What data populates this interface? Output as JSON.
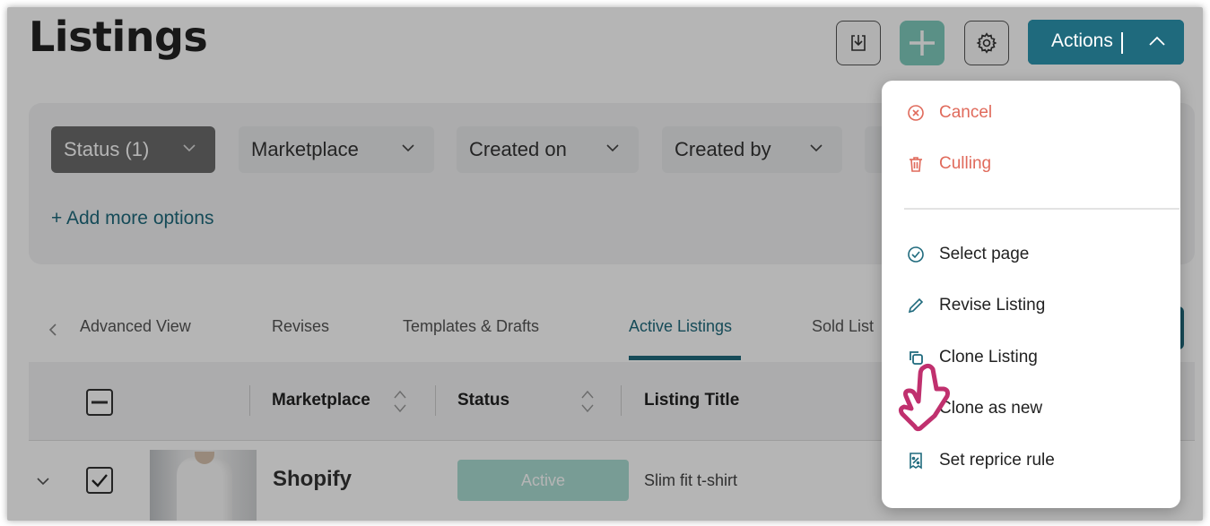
{
  "page": {
    "title": "Listings"
  },
  "toolbar": {
    "actions_label": "Actions"
  },
  "filters": {
    "chips": [
      "Status (1)",
      "Marketplace",
      "Created on",
      "Created by"
    ],
    "add_more": "+ Add more options"
  },
  "tabs": [
    "Advanced View",
    "Revises",
    "Templates & Drafts",
    "Active Listings",
    "Sold List"
  ],
  "table": {
    "headers": [
      "Marketplace",
      "Status",
      "Listing Title"
    ],
    "rows": [
      {
        "marketplace": "Shopify",
        "status": "Active",
        "title": "Slim fit t-shirt"
      }
    ]
  },
  "menu": {
    "items": [
      {
        "label": "Cancel",
        "icon": "cancel-circle-icon"
      },
      {
        "label": "Culling",
        "icon": "trash-icon"
      },
      {
        "label": "Select page",
        "icon": "check-circle-icon"
      },
      {
        "label": "Revise Listing",
        "icon": "pencil-icon"
      },
      {
        "label": "Clone Listing",
        "icon": "copy-icon"
      },
      {
        "label": "Clone as new",
        "icon": "hand-cursor-icon"
      },
      {
        "label": "Set reprice rule",
        "icon": "reprice-icon"
      }
    ]
  },
  "colors": {
    "primary": "#1f6a7d",
    "add_button": "#7fcbbd",
    "danger": "#e06a5b",
    "active_badge": "#a9dcd2",
    "pointer": "#c0306e"
  }
}
